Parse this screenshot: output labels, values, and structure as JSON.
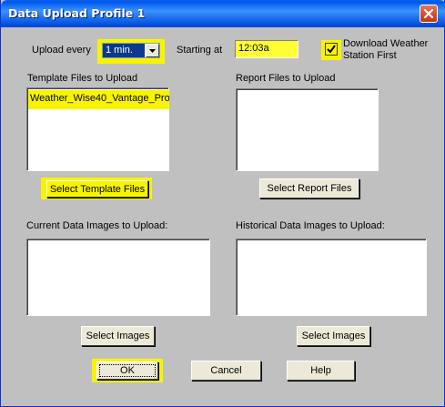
{
  "window": {
    "title": "Data Upload Profile 1"
  },
  "upload": {
    "label": "Upload every",
    "interval_value": "1 min.",
    "starting_label": "Starting at",
    "start_time": "12:03a",
    "download_label_line1": "Download Weather",
    "download_label_line2": "Station First",
    "download_checked": true
  },
  "template_files": {
    "label": "Template Files to Upload",
    "items": [
      "Weather_Wise40_Vantage_Pro"
    ],
    "button_label": "Select Template Files"
  },
  "report_files": {
    "label": "Report Files to Upload",
    "items": [],
    "button_label": "Select Report Files"
  },
  "current_images": {
    "label": "Current Data Images to Upload:",
    "items": [],
    "button_label": "Select Images"
  },
  "historical_images": {
    "label": "Historical Data Images to Upload:",
    "items": [],
    "button_label": "Select Images"
  },
  "footer": {
    "ok_label": "OK",
    "cancel_label": "Cancel",
    "help_label": "Help"
  },
  "colors": {
    "highlight": "#f8f400",
    "titlebar": "#0058ee",
    "dialog_bg": "#c0c0c0"
  },
  "icons": {
    "close": "close-x-icon",
    "dropdown": "chevron-down-icon",
    "checkbox": "checkmark-icon"
  }
}
